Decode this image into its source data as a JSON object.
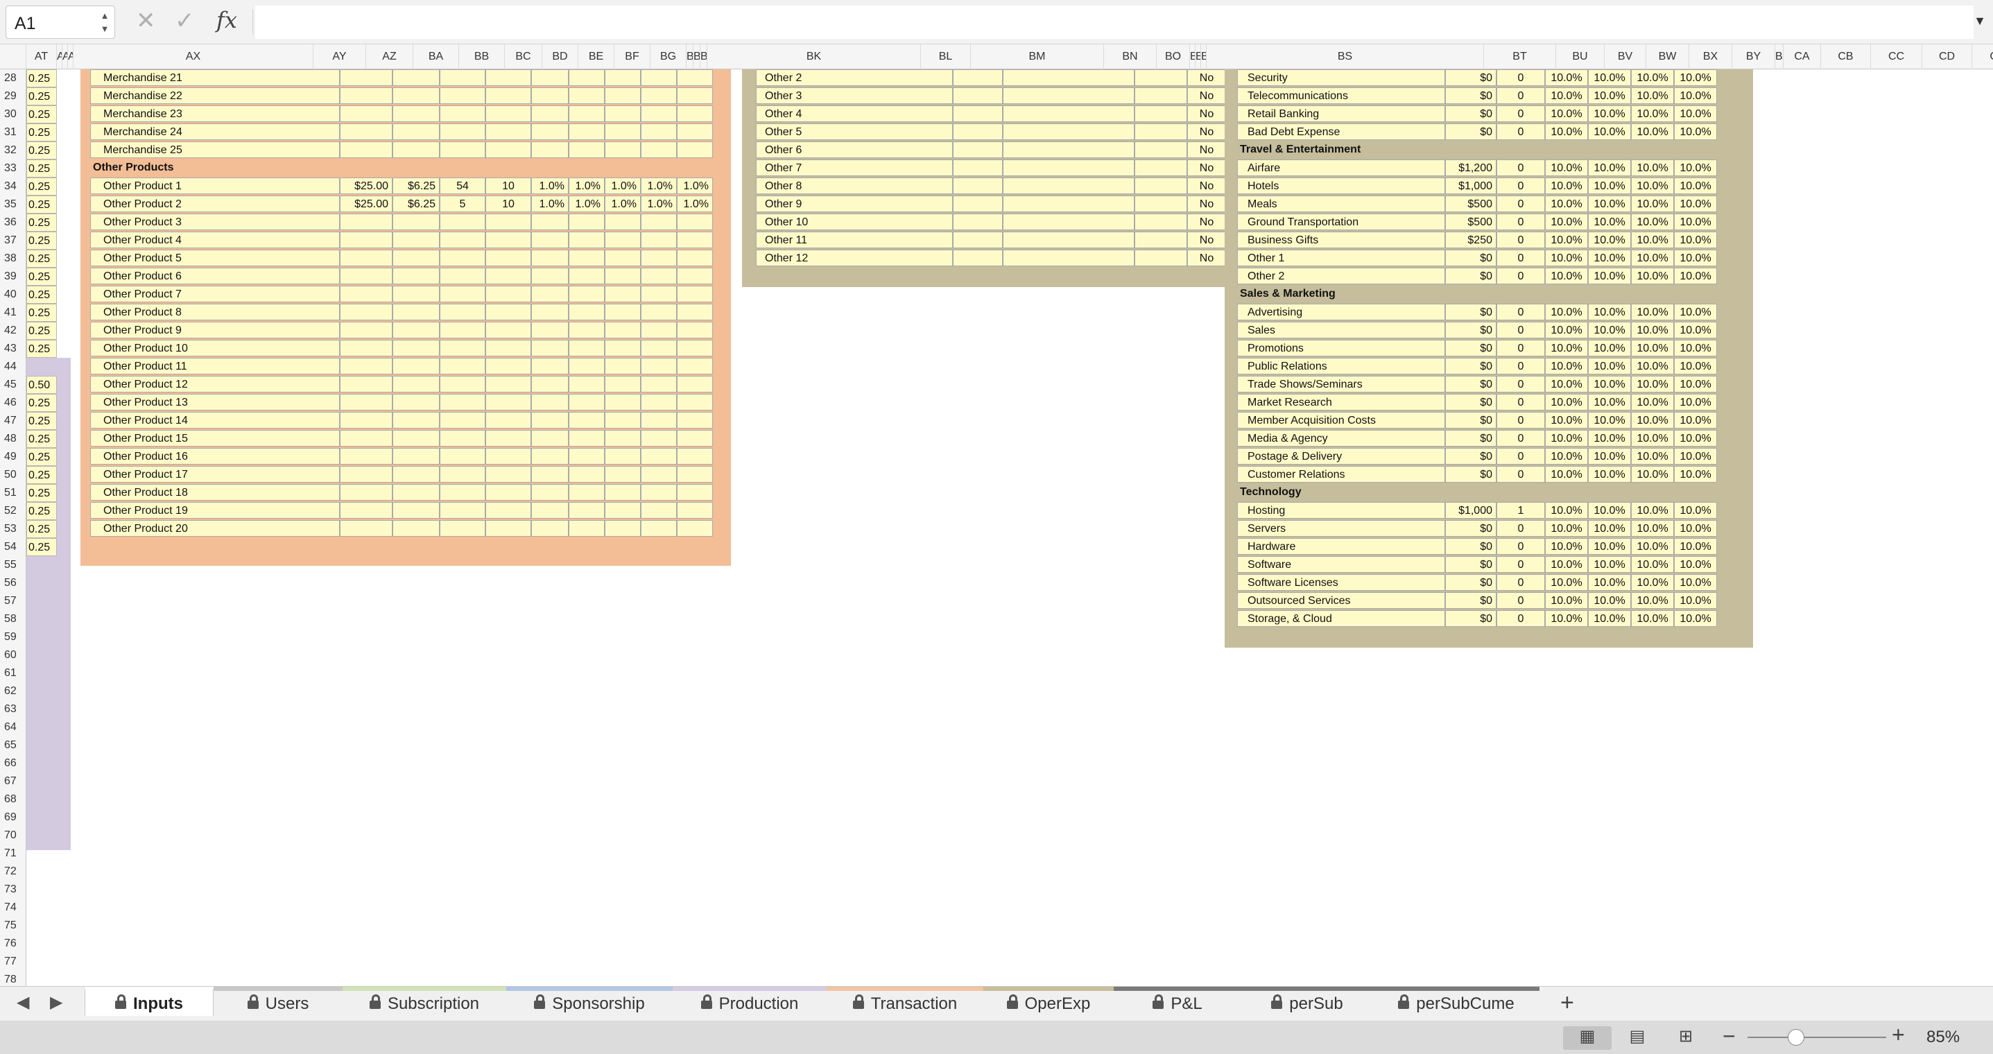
{
  "formula_bar": {
    "name_box": "A1",
    "cancel_symbol": "✕",
    "enter_symbol": "✓",
    "fx_label": "fx",
    "formula": ""
  },
  "columns": [
    "AT",
    "AU",
    "AV",
    "AW",
    "AX",
    "AY",
    "AZ",
    "BA",
    "BB",
    "BC",
    "BD",
    "BE",
    "BF",
    "BG",
    "BH",
    "BI",
    "BJ",
    "BK",
    "BL",
    "BM",
    "BN",
    "BO",
    "BP",
    "BQ",
    "BR",
    "BS",
    "BT",
    "BU",
    "BV",
    "BW",
    "BX",
    "BY",
    "BZ",
    "CA",
    "CB",
    "CC",
    "CD",
    "CE"
  ],
  "rows": [
    "28",
    "29",
    "30",
    "31",
    "32",
    "33",
    "34",
    "35",
    "36",
    "37",
    "38",
    "39",
    "40",
    "41",
    "42",
    "43",
    "44",
    "45",
    "46",
    "47",
    "48",
    "49",
    "50",
    "51",
    "52",
    "53",
    "54",
    "55",
    "56",
    "57",
    "58",
    "59",
    "60",
    "61",
    "62",
    "63",
    "64",
    "65",
    "66",
    "67",
    "68",
    "69",
    "70",
    "71",
    "72",
    "73",
    "74",
    "75",
    "76",
    "77",
    "78"
  ],
  "at_values": [
    "0.25",
    "0.25",
    "0.25",
    "0.25",
    "0.25",
    "0.25",
    "0.25",
    "0.25",
    "0.25",
    "0.25",
    "0.25",
    "0.25",
    "0.25",
    "0.25",
    "0.25",
    "0.25",
    "",
    "0.50",
    "0.25",
    "0.25",
    "0.25",
    "0.25",
    "0.25",
    "0.25",
    "0.25",
    "0.25",
    "0.25"
  ],
  "products": {
    "merch": [
      "Merchandise 21",
      "Merchandise 22",
      "Merchandise 23",
      "Merchandise 24",
      "Merchandise 25"
    ],
    "header": "Other Products",
    "rows": [
      {
        "name": "Other Product 1",
        "vals": [
          "$25.00",
          "$6.25",
          "54",
          "10",
          "1.0%",
          "1.0%",
          "1.0%",
          "1.0%",
          "1.0%"
        ]
      },
      {
        "name": "Other Product 2",
        "vals": [
          "$25.00",
          "$6.25",
          "5",
          "10",
          "1.0%",
          "1.0%",
          "1.0%",
          "1.0%",
          "1.0%"
        ]
      },
      {
        "name": "Other Product 3",
        "vals": [
          "",
          "",
          "",
          "",
          "",
          "",
          "",
          "",
          ""
        ]
      },
      {
        "name": "Other Product 4",
        "vals": [
          "",
          "",
          "",
          "",
          "",
          "",
          "",
          "",
          ""
        ]
      },
      {
        "name": "Other Product 5",
        "vals": [
          "",
          "",
          "",
          "",
          "",
          "",
          "",
          "",
          ""
        ]
      },
      {
        "name": "Other Product 6",
        "vals": [
          "",
          "",
          "",
          "",
          "",
          "",
          "",
          "",
          ""
        ]
      },
      {
        "name": "Other Product 7",
        "vals": [
          "",
          "",
          "",
          "",
          "",
          "",
          "",
          "",
          ""
        ]
      },
      {
        "name": "Other Product 8",
        "vals": [
          "",
          "",
          "",
          "",
          "",
          "",
          "",
          "",
          ""
        ]
      },
      {
        "name": "Other Product 9",
        "vals": [
          "",
          "",
          "",
          "",
          "",
          "",
          "",
          "",
          ""
        ]
      },
      {
        "name": "Other Product 10",
        "vals": [
          "",
          "",
          "",
          "",
          "",
          "",
          "",
          "",
          ""
        ]
      },
      {
        "name": "Other Product 11",
        "vals": [
          "",
          "",
          "",
          "",
          "",
          "",
          "",
          "",
          ""
        ]
      },
      {
        "name": "Other Product 12",
        "vals": [
          "",
          "",
          "",
          "",
          "",
          "",
          "",
          "",
          ""
        ]
      },
      {
        "name": "Other Product 13",
        "vals": [
          "",
          "",
          "",
          "",
          "",
          "",
          "",
          "",
          ""
        ]
      },
      {
        "name": "Other Product 14",
        "vals": [
          "",
          "",
          "",
          "",
          "",
          "",
          "",
          "",
          ""
        ]
      },
      {
        "name": "Other Product 15",
        "vals": [
          "",
          "",
          "",
          "",
          "",
          "",
          "",
          "",
          ""
        ]
      },
      {
        "name": "Other Product 16",
        "vals": [
          "",
          "",
          "",
          "",
          "",
          "",
          "",
          "",
          ""
        ]
      },
      {
        "name": "Other Product 17",
        "vals": [
          "",
          "",
          "",
          "",
          "",
          "",
          "",
          "",
          ""
        ]
      },
      {
        "name": "Other Product 18",
        "vals": [
          "",
          "",
          "",
          "",
          "",
          "",
          "",
          "",
          ""
        ]
      },
      {
        "name": "Other Product 19",
        "vals": [
          "",
          "",
          "",
          "",
          "",
          "",
          "",
          "",
          ""
        ]
      },
      {
        "name": "Other Product 20",
        "vals": [
          "",
          "",
          "",
          "",
          "",
          "",
          "",
          "",
          ""
        ]
      }
    ]
  },
  "others": {
    "rows": [
      {
        "name": "Other 2",
        "flag": "No"
      },
      {
        "name": "Other 3",
        "flag": "No"
      },
      {
        "name": "Other 4",
        "flag": "No"
      },
      {
        "name": "Other 5",
        "flag": "No"
      },
      {
        "name": "Other 6",
        "flag": "No"
      },
      {
        "name": "Other 7",
        "flag": "No"
      },
      {
        "name": "Other 8",
        "flag": "No"
      },
      {
        "name": "Other 9",
        "flag": "No"
      },
      {
        "name": "Other 10",
        "flag": "No"
      },
      {
        "name": "Other 11",
        "flag": "No"
      },
      {
        "name": "Other 12",
        "flag": "No"
      }
    ]
  },
  "expenses": {
    "rows": [
      {
        "name": "Security",
        "cost": "$0",
        "qty": "0",
        "rates": [
          "10.0%",
          "10.0%",
          "10.0%",
          "10.0%"
        ]
      },
      {
        "name": "Telecommunications",
        "cost": "$0",
        "qty": "0",
        "rates": [
          "10.0%",
          "10.0%",
          "10.0%",
          "10.0%"
        ]
      },
      {
        "name": "Retail Banking",
        "cost": "$0",
        "qty": "0",
        "rates": [
          "10.0%",
          "10.0%",
          "10.0%",
          "10.0%"
        ]
      },
      {
        "name": "Bad Debt Expense",
        "cost": "$0",
        "qty": "0",
        "rates": [
          "10.0%",
          "10.0%",
          "10.0%",
          "10.0%"
        ]
      },
      {
        "header": "Travel & Entertainment"
      },
      {
        "name": "Airfare",
        "cost": "$1,200",
        "qty": "0",
        "rates": [
          "10.0%",
          "10.0%",
          "10.0%",
          "10.0%"
        ]
      },
      {
        "name": "Hotels",
        "cost": "$1,000",
        "qty": "0",
        "rates": [
          "10.0%",
          "10.0%",
          "10.0%",
          "10.0%"
        ]
      },
      {
        "name": "Meals",
        "cost": "$500",
        "qty": "0",
        "rates": [
          "10.0%",
          "10.0%",
          "10.0%",
          "10.0%"
        ]
      },
      {
        "name": "Ground Transportation",
        "cost": "$500",
        "qty": "0",
        "rates": [
          "10.0%",
          "10.0%",
          "10.0%",
          "10.0%"
        ]
      },
      {
        "name": "Business Gifts",
        "cost": "$250",
        "qty": "0",
        "rates": [
          "10.0%",
          "10.0%",
          "10.0%",
          "10.0%"
        ]
      },
      {
        "name": "Other 1",
        "cost": "$0",
        "qty": "0",
        "rates": [
          "10.0%",
          "10.0%",
          "10.0%",
          "10.0%"
        ]
      },
      {
        "name": "Other 2",
        "cost": "$0",
        "qty": "0",
        "rates": [
          "10.0%",
          "10.0%",
          "10.0%",
          "10.0%"
        ]
      },
      {
        "header": "Sales & Marketing"
      },
      {
        "name": "Advertising",
        "cost": "$0",
        "qty": "0",
        "rates": [
          "10.0%",
          "10.0%",
          "10.0%",
          "10.0%"
        ]
      },
      {
        "name": "Sales",
        "cost": "$0",
        "qty": "0",
        "rates": [
          "10.0%",
          "10.0%",
          "10.0%",
          "10.0%"
        ]
      },
      {
        "name": "Promotions",
        "cost": "$0",
        "qty": "0",
        "rates": [
          "10.0%",
          "10.0%",
          "10.0%",
          "10.0%"
        ]
      },
      {
        "name": "Public Relations",
        "cost": "$0",
        "qty": "0",
        "rates": [
          "10.0%",
          "10.0%",
          "10.0%",
          "10.0%"
        ]
      },
      {
        "name": "Trade Shows/Seminars",
        "cost": "$0",
        "qty": "0",
        "rates": [
          "10.0%",
          "10.0%",
          "10.0%",
          "10.0%"
        ]
      },
      {
        "name": "Market Research",
        "cost": "$0",
        "qty": "0",
        "rates": [
          "10.0%",
          "10.0%",
          "10.0%",
          "10.0%"
        ]
      },
      {
        "name": "Member Acquisition Costs",
        "cost": "$0",
        "qty": "0",
        "rates": [
          "10.0%",
          "10.0%",
          "10.0%",
          "10.0%"
        ]
      },
      {
        "name": "Media & Agency",
        "cost": "$0",
        "qty": "0",
        "rates": [
          "10.0%",
          "10.0%",
          "10.0%",
          "10.0%"
        ]
      },
      {
        "name": "Postage & Delivery",
        "cost": "$0",
        "qty": "0",
        "rates": [
          "10.0%",
          "10.0%",
          "10.0%",
          "10.0%"
        ]
      },
      {
        "name": "Customer Relations",
        "cost": "$0",
        "qty": "0",
        "rates": [
          "10.0%",
          "10.0%",
          "10.0%",
          "10.0%"
        ]
      },
      {
        "header": "Technology"
      },
      {
        "name": "Hosting",
        "cost": "$1,000",
        "qty": "1",
        "rates": [
          "10.0%",
          "10.0%",
          "10.0%",
          "10.0%"
        ]
      },
      {
        "name": "Servers",
        "cost": "$0",
        "qty": "0",
        "rates": [
          "10.0%",
          "10.0%",
          "10.0%",
          "10.0%"
        ]
      },
      {
        "name": "Hardware",
        "cost": "$0",
        "qty": "0",
        "rates": [
          "10.0%",
          "10.0%",
          "10.0%",
          "10.0%"
        ]
      },
      {
        "name": "Software",
        "cost": "$0",
        "qty": "0",
        "rates": [
          "10.0%",
          "10.0%",
          "10.0%",
          "10.0%"
        ]
      },
      {
        "name": "Software Licenses",
        "cost": "$0",
        "qty": "0",
        "rates": [
          "10.0%",
          "10.0%",
          "10.0%",
          "10.0%"
        ]
      },
      {
        "name": "Outsourced Services",
        "cost": "$0",
        "qty": "0",
        "rates": [
          "10.0%",
          "10.0%",
          "10.0%",
          "10.0%"
        ]
      },
      {
        "name": "Storage, & Cloud",
        "cost": "$0",
        "qty": "0",
        "rates": [
          "10.0%",
          "10.0%",
          "10.0%",
          "10.0%"
        ]
      }
    ]
  },
  "tabs": [
    {
      "label": "Inputs",
      "color": "#f5bf86",
      "active": true
    },
    {
      "label": "Users",
      "color": "#c8c8c8",
      "active": false
    },
    {
      "label": "Subscription",
      "color": "#d1e3b5",
      "active": false
    },
    {
      "label": "Sponsorship",
      "color": "#b2c6e4",
      "active": false
    },
    {
      "label": "Production",
      "color": "#d6cbe3",
      "active": false
    },
    {
      "label": "Transaction",
      "color": "#f3c3a4",
      "active": false
    },
    {
      "label": "OperExp",
      "color": "#c9bd9a",
      "active": false
    },
    {
      "label": "P&L",
      "color": "#7a7a7a",
      "active": false
    },
    {
      "label": "perSub",
      "color": "#7a7a7a",
      "active": false
    },
    {
      "label": "perSubCume",
      "color": "#7a7a7a",
      "active": false
    }
  ],
  "tab_nav": {
    "prev": "◀",
    "next": "▶",
    "add": "+"
  },
  "zoom": {
    "value": "85%",
    "level": 0.85,
    "minus": "−",
    "plus": "+"
  },
  "colors": {
    "panel_products": "#f3bd96",
    "panel_other": "#c5bd9c",
    "panel_expenses": "#c5bd9c",
    "input_cell": "#fffbc9",
    "row_band": "#d3cae0"
  }
}
